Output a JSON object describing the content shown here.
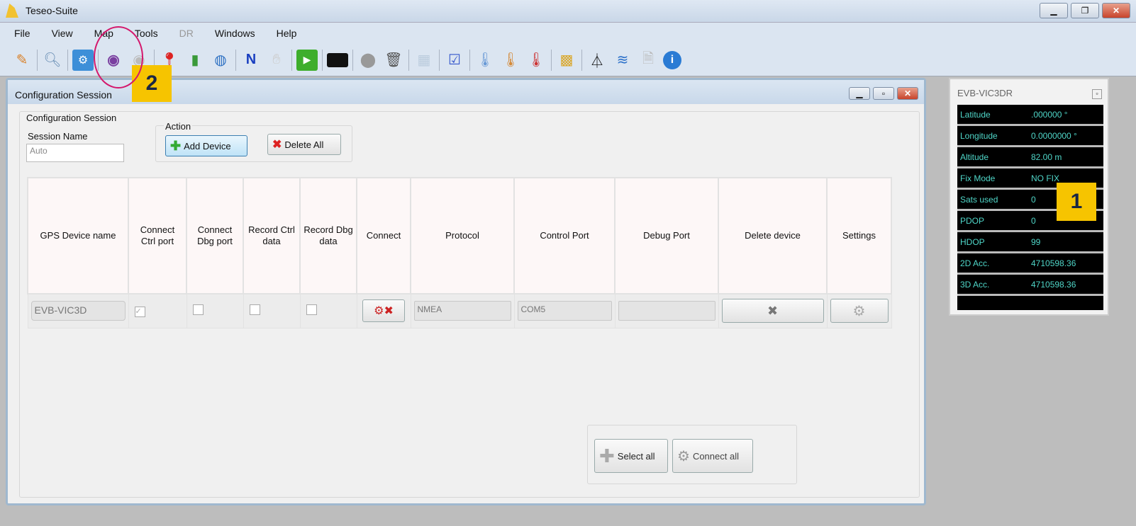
{
  "app": {
    "title": "Teseo-Suite"
  },
  "menu": [
    {
      "label": "File"
    },
    {
      "label": "View"
    },
    {
      "label": "Map"
    },
    {
      "label": "Tools"
    },
    {
      "label": "DR",
      "disabled": true
    },
    {
      "label": "Windows"
    },
    {
      "label": "Help"
    }
  ],
  "toolbar": [
    "edit-icon",
    "search-icon",
    "connect-icon",
    "nmea-view-icon",
    "view-disabled-icon",
    "pin-icon",
    "chart-icon",
    "globe-icon",
    "n-icon",
    "hand-icon",
    "play-icon",
    "terminal-icon",
    "database-icon",
    "trash-icon",
    "map-icon",
    "check-icon",
    "thermo-blue-icon",
    "thermo-orange-icon",
    "thermo-red-icon",
    "map2-icon",
    "antenna-icon",
    "wave-icon",
    "doc-icon",
    "info-icon"
  ],
  "callouts": {
    "one": "1",
    "two": "2"
  },
  "config": {
    "window_title": "Configuration Session",
    "group_title": "Configuration Session",
    "session_name_label": "Session Name",
    "session_name_value": "Auto",
    "action_label": "Action",
    "add_device": "Add Device",
    "delete_all": "Delete All",
    "columns": [
      "GPS Device name",
      "Connect Ctrl port",
      "Connect Dbg port",
      "Record Ctrl data",
      "Record Dbg data",
      "Connect",
      "Protocol",
      "Control Port",
      "Debug Port",
      "Delete device",
      "Settings"
    ],
    "row": {
      "device": "EVB-VIC3D",
      "ctrl_checked": true,
      "protocol": "NMEA",
      "control_port": "COM5",
      "debug_port": ""
    },
    "select_all": "Select all",
    "connect_all": "Connect all"
  },
  "gps_panel": {
    "title": "EVB-VIC3DR",
    "rows": [
      {
        "label": "Latitude",
        "value": ".000000 °"
      },
      {
        "label": "Longitude",
        "value": "0.0000000 °"
      },
      {
        "label": "Altitude",
        "value": "82.00 m"
      },
      {
        "label": "Fix Mode",
        "value": "NO FIX"
      },
      {
        "label": "Sats used",
        "value": "0"
      },
      {
        "label": "PDOP",
        "value": "0"
      },
      {
        "label": "HDOP",
        "value": "99"
      },
      {
        "label": "2D Acc.",
        "value": "4710598.36"
      },
      {
        "label": "3D Acc.",
        "value": "4710598.36"
      }
    ]
  }
}
